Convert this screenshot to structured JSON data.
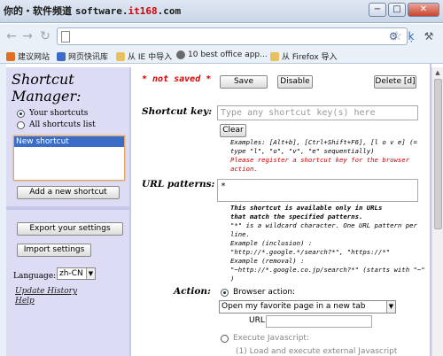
{
  "watermark": {
    "part1": "你的・软件频道",
    "site_prefix": "software.",
    "site_red": "it168",
    "site_suffix": ".com"
  },
  "window": {
    "minimize": "−",
    "maximize": "□",
    "close": "✕"
  },
  "toolbar": {
    "back_icon": "left-arrow-icon",
    "forward_icon": "right-arrow-icon",
    "reload_icon": "reload-icon",
    "address": "",
    "star_icon": "star-icon"
  },
  "bookmarks": [
    {
      "label": "建议网站",
      "color": "#e07020"
    },
    {
      "label": "网页快讯库",
      "color": "#3a6cc8"
    },
    {
      "label": "从 IE 中导入",
      "color": "#e8c060"
    },
    {
      "label": "10 best office app...",
      "color": "#6a6a6a"
    },
    {
      "label": "从 Firefox 导入",
      "color": "#e8c060"
    }
  ],
  "sidebar": {
    "title_line1": "Shortcut",
    "title_line2": "Manager:",
    "radio_yours": "Your shortcuts",
    "radio_all": "All shortcuts list",
    "list_items": [
      "New shortcut"
    ],
    "add_button": "Add a new shortcut",
    "export_button": "Export your settings",
    "import_button": "Import settings",
    "language_label": "Language:",
    "language_value": "zh-CN",
    "update_history": "Update History",
    "help": "Help"
  },
  "main": {
    "not_saved": "* not saved *",
    "save_button": "Save",
    "disable_button": "Disable",
    "delete_button": "Delete [d]",
    "shortcut_key_label": "Shortcut key:",
    "shortcut_key_placeholder": "Type any shortcut key(s) here",
    "clear_button": "Clear",
    "examples_line1": "Examples: [Alt+b], [Ctrl+Shift+F6], [l o v e] (=",
    "examples_line2": "type \"l\", \"o\", \"v\", \"e\" sequentially)",
    "register_line1": "Please register a shortcut key for the browser",
    "register_line2": "action.",
    "url_patterns_label": "URL patterns:",
    "url_patterns_value": "*",
    "urlnote_line1": "This shortcut is available only in URLs",
    "urlnote_line2": "that match the specified patterns.",
    "urlnote_line3": "\"*\" is a wildcard character. One URL pattern per",
    "urlnote_line4": "line.",
    "urlnote_line5": "Example (inclusion) :",
    "urlnote_line6": "\"http://*.google.*/search?*\", \"https://*\"",
    "urlnote_line7": "Example (removal) :",
    "urlnote_line8": "\"~http://*.google.co.jp/search?*\" (starts with \"~\"",
    "urlnote_line9": ")",
    "action_label": "Action:",
    "browser_action": "Browser action:",
    "browser_action_value": "Open my favorite page in a new tab",
    "url_label": "URL:",
    "url_value": "",
    "execute_js": "Execute Javascript:",
    "execute_js_note": "(1) Load and execute external Javascript"
  }
}
